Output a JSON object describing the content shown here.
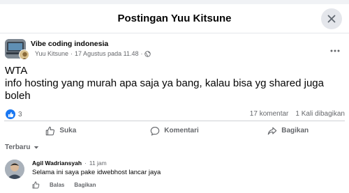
{
  "modal": {
    "title": "Postingan Yuu Kitsune"
  },
  "post": {
    "group_name": "Vibe coding indonesia",
    "author": "Yuu Kitsune",
    "separator": "·",
    "timestamp": "17 Agustus pada 11.48",
    "visibility_icon": "globe-icon",
    "text_line_1": "WTA",
    "text_line_2": "info hosting yang murah apa saja ya bang, kalau bisa yg shared juga boleh"
  },
  "stats": {
    "reaction_count": "3",
    "comments": "17 komentar",
    "shares": "1 Kali dibagikan"
  },
  "actions": {
    "like": "Suka",
    "comment": "Komentari",
    "share": "Bagikan"
  },
  "sort": {
    "label": "Terbaru"
  },
  "comment": {
    "author": "Agil Wadriansyah",
    "time": "11 jam",
    "text": "Selama ini saya pake idwebhost lancar jaya",
    "reply": "Balas",
    "share": "Bagikan"
  },
  "colors": {
    "brand": "#1877f2",
    "muted_text": "#65676b",
    "divider": "#ced0d4"
  }
}
